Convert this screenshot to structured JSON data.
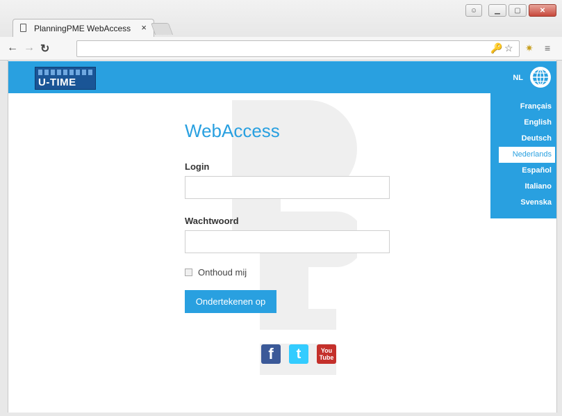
{
  "browser": {
    "tab_title": "PlanningPME WebAccess",
    "tab_close": "×",
    "url": ""
  },
  "header": {
    "logo_text": "U-TIME",
    "lang_code": "NL"
  },
  "languages": [
    {
      "label": "Français",
      "active": false
    },
    {
      "label": "English",
      "active": false
    },
    {
      "label": "Deutsch",
      "active": false
    },
    {
      "label": "Nederlands",
      "active": true
    },
    {
      "label": "Español",
      "active": false
    },
    {
      "label": "Italiano",
      "active": false
    },
    {
      "label": "Svenska",
      "active": false
    }
  ],
  "form": {
    "heading": "WebAccess",
    "login_label": "Login",
    "login_value": "",
    "password_label": "Wachtwoord",
    "password_value": "",
    "remember_label": "Onthoud mij",
    "remember_checked": false,
    "submit_label": "Ondertekenen op"
  },
  "social": {
    "facebook": "f",
    "twitter": "t",
    "youtube_top": "You",
    "youtube_bottom": "Tube"
  },
  "colors": {
    "accent": "#29a0e0",
    "logo_bg": "#1a5596"
  }
}
